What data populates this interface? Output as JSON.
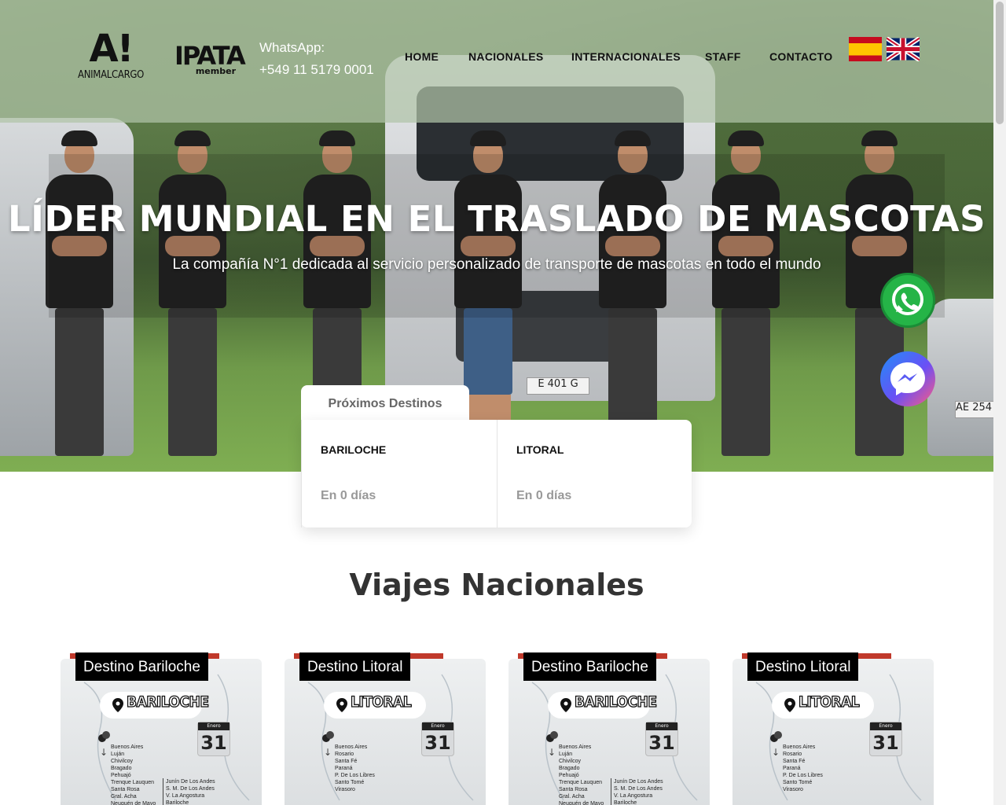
{
  "header": {
    "logo_mark": "A!",
    "logo_word": "ANIMALCARGO",
    "ipata_logo": "IPATA",
    "ipata_sub": "member",
    "whatsapp_label": "WhatsApp:",
    "whatsapp_number": "+549 11 5179 0001",
    "nav": [
      "HOME",
      "NACIONALES",
      "INTERNACIONALES",
      "STAFF",
      "CONTACTO"
    ],
    "languages": [
      "Español",
      "English"
    ]
  },
  "hero": {
    "title": "LÍDER MUNDIAL EN EL TRASLADO DE MASCOTAS",
    "subtitle": "La compañía N°1 dedicada al servicio personalizado de transporte de mascotas en todo el mundo",
    "plate_center": "E 401 G",
    "plate_right": "AE 254"
  },
  "floating": {
    "whatsapp_icon": "whatsapp-icon",
    "messenger_icon": "messenger-icon"
  },
  "destinos": {
    "tab_label": "Próximos Destinos",
    "items": [
      {
        "name": "BARILOCHE",
        "countdown": "En 0 días"
      },
      {
        "name": "LITORAL",
        "countdown": "En 0 días"
      }
    ]
  },
  "section": {
    "title": "Viajes Nacionales"
  },
  "trips": [
    {
      "label": "Destino Bariloche",
      "badge": "BARILOCHE",
      "month": "Enero",
      "day": "31",
      "stops": [
        "Buenos Aires",
        "Luján",
        "Chivilcoy",
        "Bragado",
        "Pehuajó",
        "Trenque Lauquen",
        "Santa Rosa",
        "Gral. Acha",
        "Neuquén de Mayo"
      ],
      "stops_end": [
        "Junín De Los Andes",
        "S. M. De Los Andes",
        "V. La Angostura",
        "Bariloche"
      ]
    },
    {
      "label": "Destino Litoral",
      "badge": "LITORAL",
      "month": "Enero",
      "day": "31",
      "stops": [
        "Buenos Aires",
        "Rosario",
        "Santa Fé",
        "Paraná",
        "P. De Los Libres",
        "Santo Tomé",
        "Virasoro"
      ],
      "stops_end": []
    },
    {
      "label": "Destino Bariloche",
      "badge": "BARILOCHE",
      "month": "Enero",
      "day": "31",
      "stops": [
        "Buenos Aires",
        "Luján",
        "Chivilcoy",
        "Bragado",
        "Pehuajó",
        "Trenque Lauquen",
        "Santa Rosa",
        "Gral. Acha",
        "Neuquén de Mayo"
      ],
      "stops_end": [
        "Junín De Los Andes",
        "S. M. De Los Andes",
        "V. La Angostura",
        "Bariloche"
      ]
    },
    {
      "label": "Destino Litoral",
      "badge": "LITORAL",
      "month": "Enero",
      "day": "31",
      "stops": [
        "Buenos Aires",
        "Rosario",
        "Santa Fé",
        "Paraná",
        "P. De Los Libres",
        "Santo Tomé",
        "Virasoro"
      ],
      "stops_end": []
    }
  ],
  "colors": {
    "header_overlay": "#b0c4a8",
    "whatsapp_green": "#25b447",
    "label_black": "#000000",
    "ribbon_red": "#c0392b"
  }
}
